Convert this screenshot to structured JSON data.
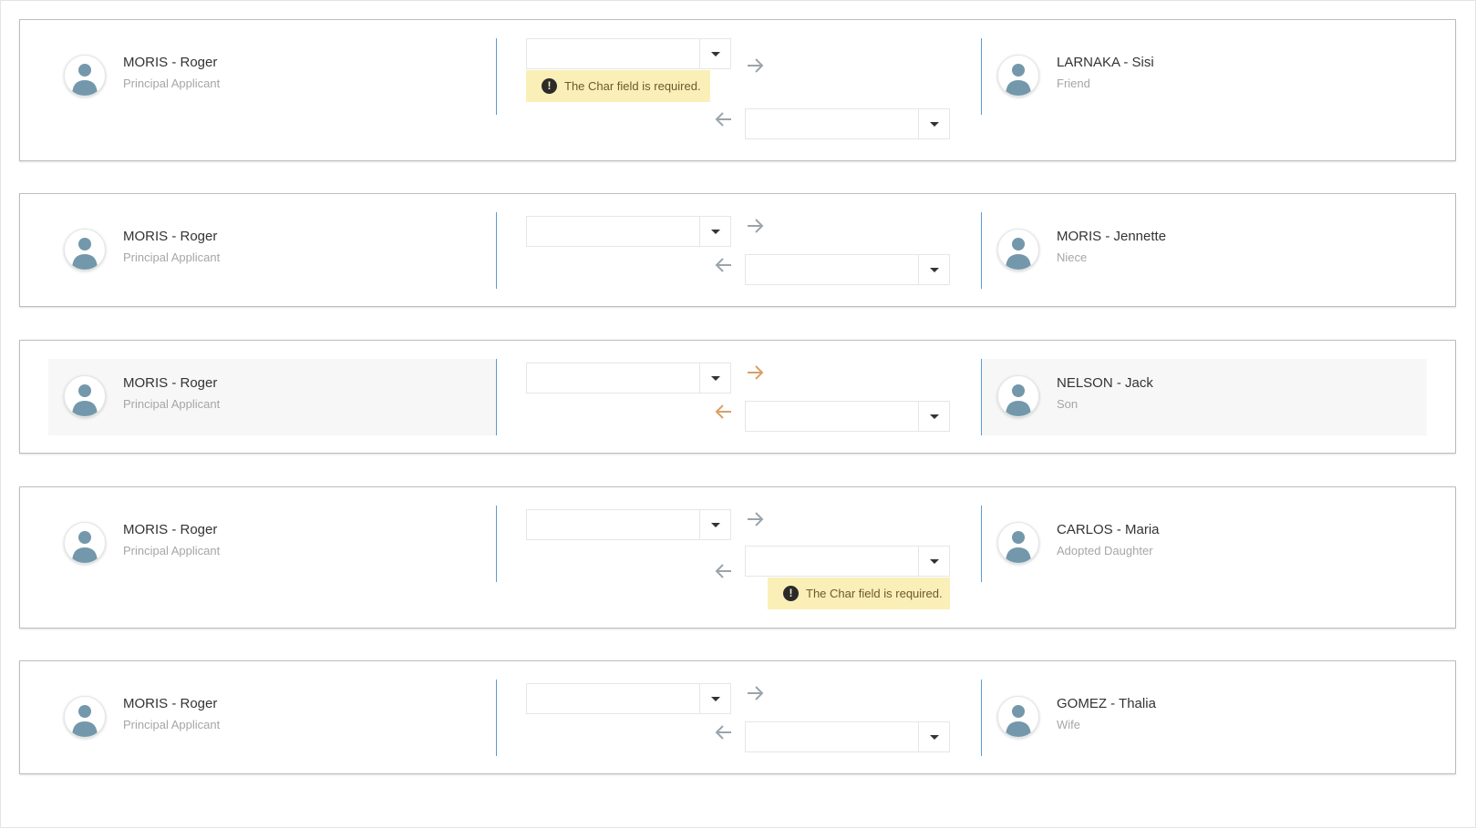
{
  "colors": {
    "accent_line": "#5b9bd5",
    "arrow_default": "#9aa4ab",
    "arrow_active": "#d9a066",
    "warning_bg": "#fbefb8",
    "avatar_fill": "#7398ab"
  },
  "rows": [
    {
      "left": {
        "name": "MORIS - Roger",
        "role": "Principal Applicant"
      },
      "right": {
        "name": "LARNAKA - Sisi",
        "role": "Friend"
      },
      "forward_select": {
        "value": ""
      },
      "backward_select": {
        "value": ""
      },
      "forward_error": "The Char field is required.",
      "backward_error": null,
      "highlighted": false
    },
    {
      "left": {
        "name": "MORIS - Roger",
        "role": "Principal Applicant"
      },
      "right": {
        "name": "MORIS - Jennette",
        "role": "Niece"
      },
      "forward_select": {
        "value": ""
      },
      "backward_select": {
        "value": ""
      },
      "forward_error": null,
      "backward_error": null,
      "highlighted": false
    },
    {
      "left": {
        "name": "MORIS - Roger",
        "role": "Principal Applicant"
      },
      "right": {
        "name": "NELSON - Jack",
        "role": "Son"
      },
      "forward_select": {
        "value": ""
      },
      "backward_select": {
        "value": ""
      },
      "forward_error": null,
      "backward_error": null,
      "highlighted": true
    },
    {
      "left": {
        "name": "MORIS - Roger",
        "role": "Principal Applicant"
      },
      "right": {
        "name": "CARLOS - Maria",
        "role": "Adopted Daughter"
      },
      "forward_select": {
        "value": ""
      },
      "backward_select": {
        "value": ""
      },
      "forward_error": null,
      "backward_error": "The Char field is required.",
      "highlighted": false
    },
    {
      "left": {
        "name": "MORIS - Roger",
        "role": "Principal Applicant"
      },
      "right": {
        "name": "GOMEZ - Thalia",
        "role": "Wife"
      },
      "forward_select": {
        "value": ""
      },
      "backward_select": {
        "value": ""
      },
      "forward_error": null,
      "backward_error": null,
      "highlighted": false
    }
  ]
}
